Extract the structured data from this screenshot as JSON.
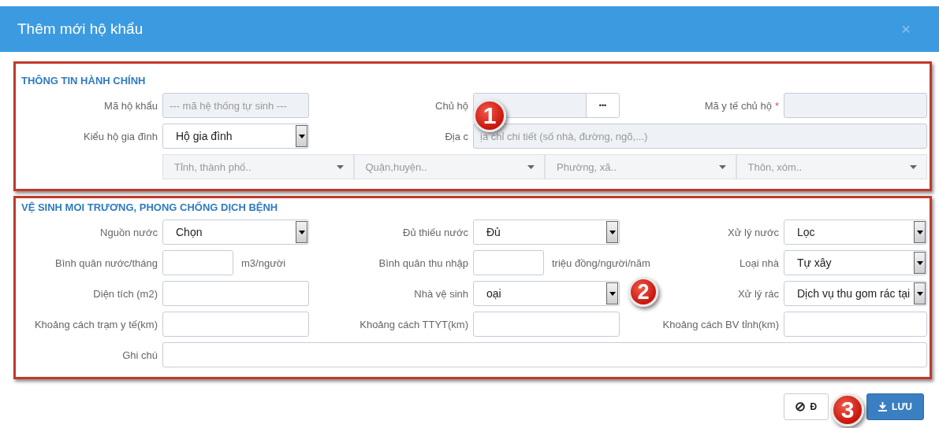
{
  "dialog": {
    "title": "Thêm mới hộ khẩu",
    "close": "×"
  },
  "sections": [
    {
      "title": "THÔNG TIN HÀNH CHÍNH",
      "fields": [
        {
          "label": "Mã hộ khẩu",
          "kind": "text",
          "placeholder": "--- mã hệ thống tự sinh ---",
          "disabled": true
        },
        {
          "label": "Chủ hộ",
          "kind": "lookup",
          "button": "•••",
          "disabled": true
        },
        {
          "label": "Mã y tế chủ hộ",
          "kind": "text",
          "disabled": true,
          "required_mark": "*"
        },
        {
          "label": "Kiểu hộ gia đình",
          "kind": "select",
          "value": "Hộ gia đình",
          "disabled": false
        },
        {
          "label": "Địa c",
          "kind": "wide",
          "placeholder": "ịa chỉ chi tiết (số nhà, đường, ngõ,...)",
          "disabled": true
        }
      ],
      "address_selects": [
        {
          "placeholder": "Tỉnh, thành phố.."
        },
        {
          "placeholder": "Quận,huyện.."
        },
        {
          "placeholder": "Phường, xã.."
        },
        {
          "placeholder": "Thôn, xóm.."
        }
      ]
    },
    {
      "title": "VỆ SINH MOI TRƯƠNG, PHONG CHỐNG DỊCH BỆNH",
      "fields": [
        {
          "label": "Nguồn nước",
          "kind": "select",
          "value": "Chọn",
          "disabled": false
        },
        {
          "label": "Đủ thiếu nước",
          "kind": "select",
          "value": "Đủ",
          "disabled": false
        },
        {
          "label": "Xử lý nước",
          "kind": "select",
          "value": "Lọc",
          "disabled": false
        },
        {
          "label": "Bình quân nước/tháng",
          "kind": "unit",
          "unit": "m3/người",
          "disabled": false
        },
        {
          "label": "Bình quân thu nhập",
          "kind": "unit",
          "unit": "triệu đồng/người/năm",
          "disabled": false
        },
        {
          "label": "Loại nhà",
          "kind": "select",
          "value": "Tự xây",
          "disabled": false
        },
        {
          "label": "Diện tích (m2)",
          "kind": "text",
          "disabled": false
        },
        {
          "label": "Nhà vệ sinh",
          "kind": "select",
          "value": "oại",
          "disabled": false
        },
        {
          "label": "Xử lý rác",
          "kind": "select",
          "value": "Dịch vụ thu gom rác tại",
          "disabled": false
        },
        {
          "label": "Khoảng cách trạm y tế(km)",
          "kind": "text",
          "disabled": false
        },
        {
          "label": "Khoảng cách TTYT(km)",
          "kind": "text",
          "disabled": false
        },
        {
          "label": "Khoảng cách BV tỉnh(km)",
          "kind": "text",
          "disabled": false
        },
        {
          "label": "Ghi chú",
          "kind": "wide",
          "disabled": false
        }
      ]
    }
  ],
  "buttons": [
    {
      "label": "Đ",
      "kind": "cancel"
    },
    {
      "label": "LƯU",
      "kind": "save"
    }
  ],
  "callouts": [
    "1",
    "2",
    "3"
  ]
}
